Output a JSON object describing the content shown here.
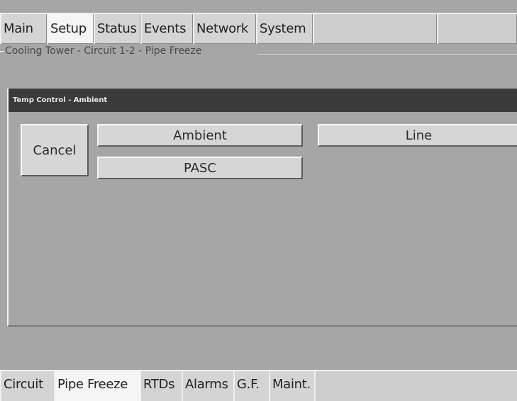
{
  "top_tabs": {
    "main": "Main",
    "setup": "Setup",
    "status": "Status",
    "events": "Events",
    "network": "Network",
    "system": "System"
  },
  "breadcrumb": "Cooling Tower - Circuit 1-2 - Pipe Freeze",
  "dialog": {
    "title": "Temp Control - Ambient",
    "cancel_label": "Cancel",
    "ambient_label": "Ambient",
    "pasc_label": "PASC",
    "line_label": "Line"
  },
  "bottom_tabs": {
    "circuit": "Circuit",
    "pipe_freeze": "Pipe Freeze",
    "rtds": "RTDs",
    "alarms": "Alarms",
    "gf": "G.F.",
    "maint": "Maint."
  },
  "colors": {
    "background": "#a6a6a6",
    "button_face": "#d6d6d6",
    "title_bar": "#3a3a3a",
    "active_tab": "#f5f5f5"
  }
}
